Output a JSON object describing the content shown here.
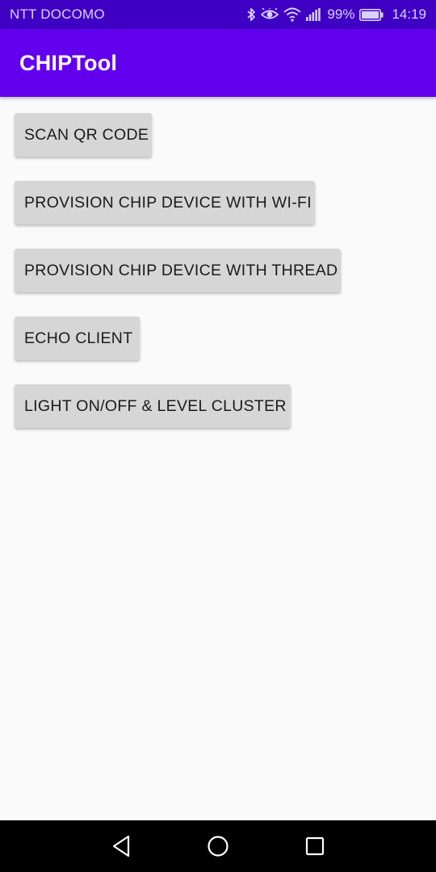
{
  "status_bar": {
    "carrier": "NTT DOCOMO",
    "battery_percent": "99%",
    "time": "14:19",
    "icons": [
      "bluetooth-icon",
      "eye-icon",
      "wifi-icon",
      "signal-icon",
      "battery-icon"
    ],
    "background_color": "#3f00c4"
  },
  "app_bar": {
    "title": "CHIPTool",
    "background_color": "#6200ee"
  },
  "buttons": [
    {
      "label": "SCAN QR CODE"
    },
    {
      "label": "PROVISION CHIP DEVICE WITH WI-FI"
    },
    {
      "label": "PROVISION CHIP DEVICE WITH THREAD"
    },
    {
      "label": "ECHO CLIENT"
    },
    {
      "label": "LIGHT ON/OFF & LEVEL CLUSTER"
    }
  ],
  "nav_bar": {
    "icons": [
      "back-icon",
      "home-icon",
      "recent-apps-icon"
    ]
  }
}
